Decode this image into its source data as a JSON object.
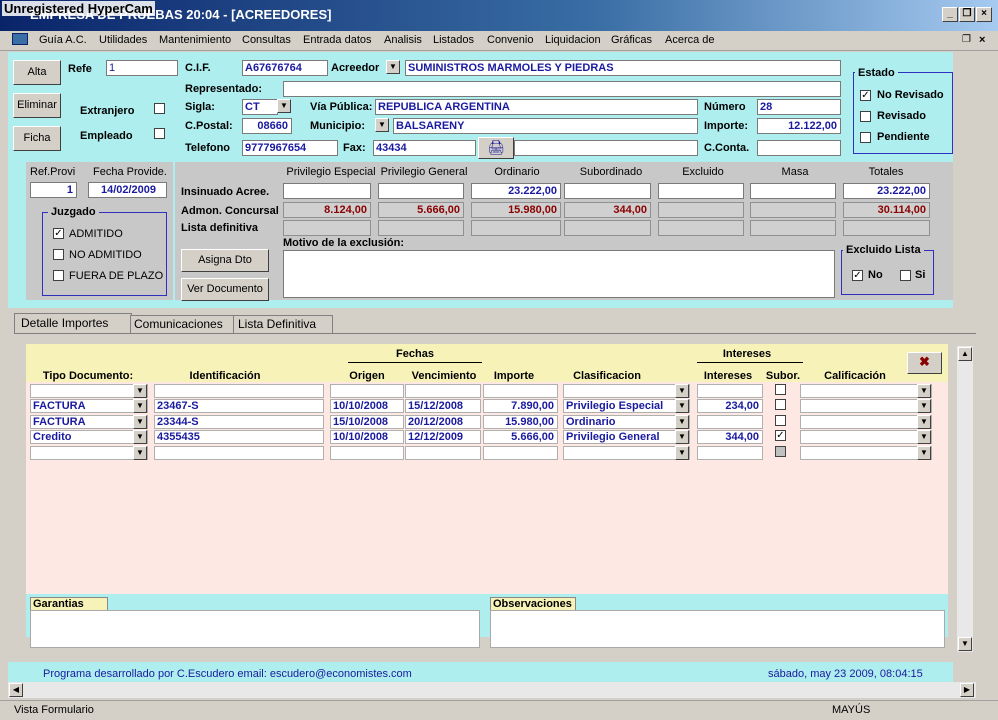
{
  "watermark": "Unregistered HyperCam",
  "window_title": "EMPRESA DE PRUEBAS  20:04 - [ACREEDORES]",
  "menu": [
    "Guía A.C.",
    "Utilidades",
    "Mantenimiento",
    "Consultas",
    "Entrada datos",
    "Analisis",
    "Listados",
    "Convenio",
    "Liquidacion",
    "Gráficas",
    "Acerca de"
  ],
  "buttons": {
    "alta": "Alta",
    "eliminar": "Eliminar",
    "ficha": "Ficha",
    "asigna": "Asigna Dto",
    "ver_doc": "Ver Documento"
  },
  "labels": {
    "refe": "Refe",
    "cif": "C.I.F.",
    "acreedor": "Acreedor",
    "representado": "Representado:",
    "sigla": "Sigla:",
    "via": "Vía Pública:",
    "numero": "Número",
    "cpostal": "C.Postal:",
    "municipio": "Municipio:",
    "importe": "Importe:",
    "telefono": "Telefono",
    "fax": "Fax:",
    "cconta": "C.Conta.",
    "extranjero": "Extranjero",
    "empleado": "Empleado"
  },
  "values": {
    "refe": "1",
    "cif": "A67676764",
    "acreedor": "SUMINISTROS MARMOLES Y PIEDRAS",
    "sigla": "CT",
    "via": "REPUBLICA ARGENTINA",
    "numero": "28",
    "cpostal": "08660",
    "municipio": "BALSARENY",
    "importe": "12.122,00",
    "telefono": "9777967654",
    "fax": "43434"
  },
  "estado": {
    "title": "Estado",
    "options": [
      "No Revisado",
      "Revisado",
      "Pendiente"
    ]
  },
  "refprovi": {
    "label": "Ref.Provi",
    "value": "1"
  },
  "fecha_provide": {
    "label": "Fecha Provide.",
    "value": "14/02/2009"
  },
  "juzgado": {
    "title": "Juzgado",
    "options": [
      "ADMITIDO",
      "NO ADMITIDO",
      "FUERA DE PLAZO"
    ]
  },
  "grid_cols": [
    "Privilegio Especial",
    "Privilegio General",
    "Ordinario",
    "Subordinado",
    "Excluido",
    "Masa",
    "Totales"
  ],
  "grid_rows": {
    "insinuado": {
      "label": "Insinuado Acree.",
      "vals": [
        "",
        "",
        "23.222,00",
        "",
        "",
        "",
        "23.222,00"
      ]
    },
    "admon": {
      "label": "Admon. Concursal",
      "vals": [
        "8.124,00",
        "5.666,00",
        "15.980,00",
        "344,00",
        "",
        "",
        "30.114,00"
      ]
    },
    "lista": {
      "label": "Lista definitiva"
    }
  },
  "motivo": "Motivo de la exclusión:",
  "excluido": {
    "title": "Excluido Lista",
    "no": "No",
    "si": "Si"
  },
  "tabs": [
    "Detalle Importes",
    "Comunicaciones",
    "Lista Definitiva"
  ],
  "detail_headers": {
    "tipo": "Tipo Documento:",
    "ident": "Identificación",
    "fechas": "Fechas",
    "origen": "Origen",
    "venc": "Vencimiento",
    "importe": "Importe",
    "clasif": "Clasificacion",
    "intereses_grp": "Intereses",
    "intereses": "Intereses",
    "subor": "Subor.",
    "calif": "Calificación"
  },
  "detail_rows": [
    {
      "tipo": "FACTURA",
      "ident": "23467-S",
      "origen": "10/10/2008",
      "venc": "15/12/2008",
      "importe": "7.890,00",
      "clasif": "Privilegio Especial",
      "intereses": "234,00",
      "subor": false
    },
    {
      "tipo": "FACTURA",
      "ident": "23344-S",
      "origen": "15/10/2008",
      "venc": "20/12/2008",
      "importe": "15.980,00",
      "clasif": "Ordinario",
      "intereses": "",
      "subor": false
    },
    {
      "tipo": "Credito",
      "ident": "4355435",
      "origen": "10/10/2008",
      "venc": "12/12/2009",
      "importe": "5.666,00",
      "clasif": "Privilegio General",
      "intereses": "344,00",
      "subor": true
    }
  ],
  "garantias": "Garantias",
  "observaciones": "Observaciones",
  "footer_left": "Programa desarrollado por  C.Escudero   email: escudero@economistes.com",
  "footer_right": "sábado, may 23 2009, 08:04:15",
  "status_left": "Vista Formulario",
  "status_right": "MAYÚS"
}
